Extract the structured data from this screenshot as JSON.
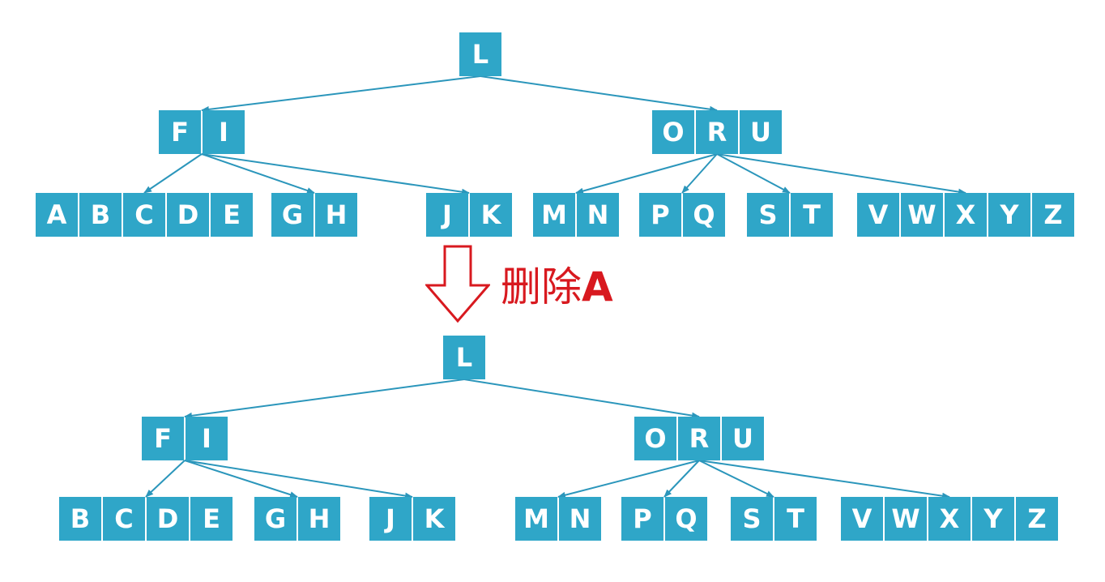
{
  "colors": {
    "node": "#2fa6c8",
    "edge": "#2b96bb",
    "text": "#ffffff",
    "arrow": "#d8191f"
  },
  "caption": {
    "verb": "删除",
    "key": "A"
  },
  "trees": [
    {
      "id": "before",
      "nodes": [
        {
          "id": "root",
          "keys": [
            "L"
          ]
        },
        {
          "id": "left",
          "keys": [
            "F",
            "I"
          ]
        },
        {
          "id": "right",
          "keys": [
            "O",
            "R",
            "U"
          ]
        },
        {
          "id": "leaf1",
          "keys": [
            "A",
            "B",
            "C",
            "D",
            "E"
          ]
        },
        {
          "id": "leaf2",
          "keys": [
            "G",
            "H"
          ]
        },
        {
          "id": "leaf3",
          "keys": [
            "J",
            "K"
          ]
        },
        {
          "id": "leaf4",
          "keys": [
            "M",
            "N"
          ]
        },
        {
          "id": "leaf5",
          "keys": [
            "P",
            "Q"
          ]
        },
        {
          "id": "leaf6",
          "keys": [
            "S",
            "T"
          ]
        },
        {
          "id": "leaf7",
          "keys": [
            "V",
            "W",
            "X",
            "Y",
            "Z"
          ]
        }
      ],
      "edges": [
        [
          "root",
          "left"
        ],
        [
          "root",
          "right"
        ],
        [
          "left",
          "leaf1"
        ],
        [
          "left",
          "leaf2"
        ],
        [
          "left",
          "leaf3"
        ],
        [
          "right",
          "leaf4"
        ],
        [
          "right",
          "leaf5"
        ],
        [
          "right",
          "leaf6"
        ],
        [
          "right",
          "leaf7"
        ]
      ]
    },
    {
      "id": "after",
      "nodes": [
        {
          "id": "root",
          "keys": [
            "L"
          ]
        },
        {
          "id": "left",
          "keys": [
            "F",
            "I"
          ]
        },
        {
          "id": "right",
          "keys": [
            "O",
            "R",
            "U"
          ]
        },
        {
          "id": "leaf1",
          "keys": [
            "B",
            "C",
            "D",
            "E"
          ]
        },
        {
          "id": "leaf2",
          "keys": [
            "G",
            "H"
          ]
        },
        {
          "id": "leaf3",
          "keys": [
            "J",
            "K"
          ]
        },
        {
          "id": "leaf4",
          "keys": [
            "M",
            "N"
          ]
        },
        {
          "id": "leaf5",
          "keys": [
            "P",
            "Q"
          ]
        },
        {
          "id": "leaf6",
          "keys": [
            "S",
            "T"
          ]
        },
        {
          "id": "leaf7",
          "keys": [
            "V",
            "W",
            "X",
            "Y",
            "Z"
          ]
        }
      ],
      "edges": [
        [
          "root",
          "left"
        ],
        [
          "root",
          "right"
        ],
        [
          "left",
          "leaf1"
        ],
        [
          "left",
          "leaf2"
        ],
        [
          "left",
          "leaf3"
        ],
        [
          "right",
          "leaf4"
        ],
        [
          "right",
          "leaf5"
        ],
        [
          "right",
          "leaf6"
        ],
        [
          "right",
          "leaf7"
        ]
      ]
    }
  ]
}
